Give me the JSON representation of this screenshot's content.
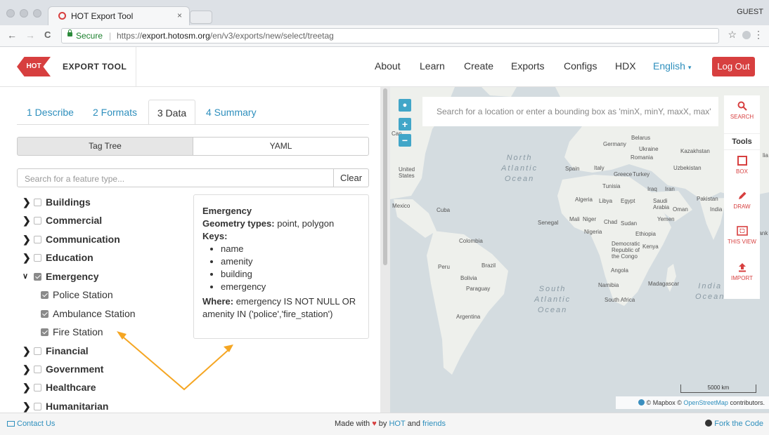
{
  "browser": {
    "tab_title": "HOT Export Tool",
    "tab_close": "×",
    "profile": "GUEST",
    "back": "←",
    "forward": "→",
    "reload": "C",
    "secure_label": "Secure",
    "separator": "|",
    "url_scheme": "https://",
    "url_host": "export.hotosm.org",
    "url_path": "/en/v3/exports/new/select/treetag",
    "star": "☆",
    "menu": "⋮"
  },
  "header": {
    "logo_badge": "HOT",
    "logo_text": "EXPORT TOOL",
    "nav": [
      "About",
      "Learn",
      "Create",
      "Exports",
      "Configs",
      "HDX"
    ],
    "language": "English",
    "logout": "Log Out"
  },
  "steps": {
    "tabs": [
      "1 Describe",
      "2 Formats",
      "3 Data",
      "4 Summary"
    ],
    "active": "3 Data"
  },
  "data_panel": {
    "toggle": [
      "Tag Tree",
      "YAML"
    ],
    "search_placeholder": "Search for a feature type...",
    "clear": "Clear",
    "tree": [
      {
        "label": "Buildings",
        "expanded": false,
        "checked": false
      },
      {
        "label": "Commercial",
        "expanded": false,
        "checked": false
      },
      {
        "label": "Communication",
        "expanded": false,
        "checked": false
      },
      {
        "label": "Education",
        "expanded": false,
        "checked": false
      },
      {
        "label": "Emergency",
        "expanded": true,
        "checked": true,
        "children": [
          "Police Station",
          "Ambulance Station",
          "Fire Station"
        ]
      },
      {
        "label": "Financial",
        "expanded": false,
        "checked": false
      },
      {
        "label": "Government",
        "expanded": false,
        "checked": false
      },
      {
        "label": "Healthcare",
        "expanded": false,
        "checked": false
      },
      {
        "label": "Humanitarian",
        "expanded": false,
        "checked": false
      }
    ],
    "info": {
      "title": "Emergency",
      "geometry_label": "Geometry types:",
      "geometry_value": "point, polygon",
      "keys_label": "Keys:",
      "keys": [
        "name",
        "amenity",
        "building",
        "emergency"
      ],
      "where_label": "Where:",
      "where_value": "emergency IS NOT NULL OR amenity IN ('police','fire_station')"
    }
  },
  "map": {
    "search_placeholder": "Search for a location or enter a bounding box as 'minX, minY, maxX, max'",
    "zoom_in": "+",
    "zoom_out": "−",
    "tools_label": "Tools",
    "tools": [
      "SEARCH",
      "BOX",
      "DRAW",
      "THIS VIEW",
      "IMPORT"
    ],
    "oceans": {
      "north_atlantic": [
        "North",
        "Atlantic",
        "Ocean"
      ],
      "south_atlantic": [
        "South",
        "Atlantic",
        "Ocean"
      ],
      "indian": [
        "India",
        "Ocean"
      ]
    },
    "labels": {
      "canada": "Can",
      "united_states": "United States",
      "mexico": "Mexico",
      "cuba": "Cuba",
      "colombia": "Colombia",
      "peru": "Peru",
      "brazil": "Brazil",
      "bolivia": "Bolivia",
      "paraguay": "Paraguay",
      "argentina": "Argentina",
      "germany": "Germany",
      "belarus": "Belarus",
      "ukraine": "Ukraine",
      "romania": "Romania",
      "kazakhstan": "Kazakhstan",
      "uzbekistan": "Uzbekistan",
      "spain": "Spain",
      "italy": "Italy",
      "greece": "Greece",
      "turkey": "Turkey",
      "tunisia": "Tunisia",
      "iraq": "Iraq",
      "iran": "Iran",
      "pakistan": "Pakistan",
      "algeria": "Algeria",
      "libya": "Libya",
      "egypt": "Egypt",
      "saudi_arabia": "Saudi Arabia",
      "oman": "Oman",
      "india": "India",
      "yemen": "Yemen",
      "mali": "Mali",
      "niger": "Niger",
      "chad": "Chad",
      "sudan": "Sudan",
      "senegal": "Senegal",
      "nigeria": "Nigeria",
      "ethiopia": "Ethiopia",
      "sri_lanka": "Sri Lank",
      "drc": "Democratic Republic of the Congo",
      "kenya": "Kenya",
      "angola": "Angola",
      "namibia": "Namibia",
      "madagascar": "Madagascar",
      "south_africa": "South Africa",
      "edge_lia": "lia"
    },
    "scale": "5000 km",
    "attribution_sep": "©",
    "attribution_mapbox": "Mapbox",
    "attribution_osm": "OpenStreetMap",
    "attribution_tail": "contributors."
  },
  "footer": {
    "contact": "Contact Us",
    "made_with": "Made with",
    "by": "by",
    "hot": "HOT",
    "and": "and",
    "friends": "friends",
    "fork": "Fork the Code"
  },
  "colors": {
    "brand_red": "#d73f3f",
    "link_blue": "#2e8fbd",
    "arrow_orange": "#f5a623"
  }
}
